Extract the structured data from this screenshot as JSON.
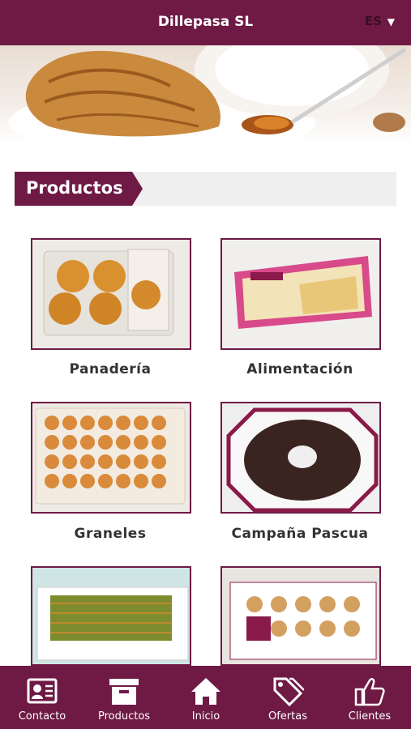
{
  "header": {
    "title": "Dillepasa SL",
    "language": "ES",
    "language_caret": "▼"
  },
  "section": {
    "title": "Productos"
  },
  "products": [
    {
      "label": "Panadería"
    },
    {
      "label": "Alimentación"
    },
    {
      "label": "Graneles"
    },
    {
      "label": "Campaña Pascua"
    },
    {
      "label": ""
    },
    {
      "label": ""
    }
  ],
  "bottom_nav": [
    {
      "label": "Contacto",
      "icon": "contact-card-icon"
    },
    {
      "label": "Productos",
      "icon": "archive-box-icon"
    },
    {
      "label": "Inicio",
      "icon": "home-icon"
    },
    {
      "label": "Ofertas",
      "icon": "tags-icon"
    },
    {
      "label": "Clientes",
      "icon": "thumbs-up-icon"
    }
  ],
  "colors": {
    "brand": "#6e1a45",
    "section_bar": "#efefef",
    "text_dark": "#333333"
  }
}
